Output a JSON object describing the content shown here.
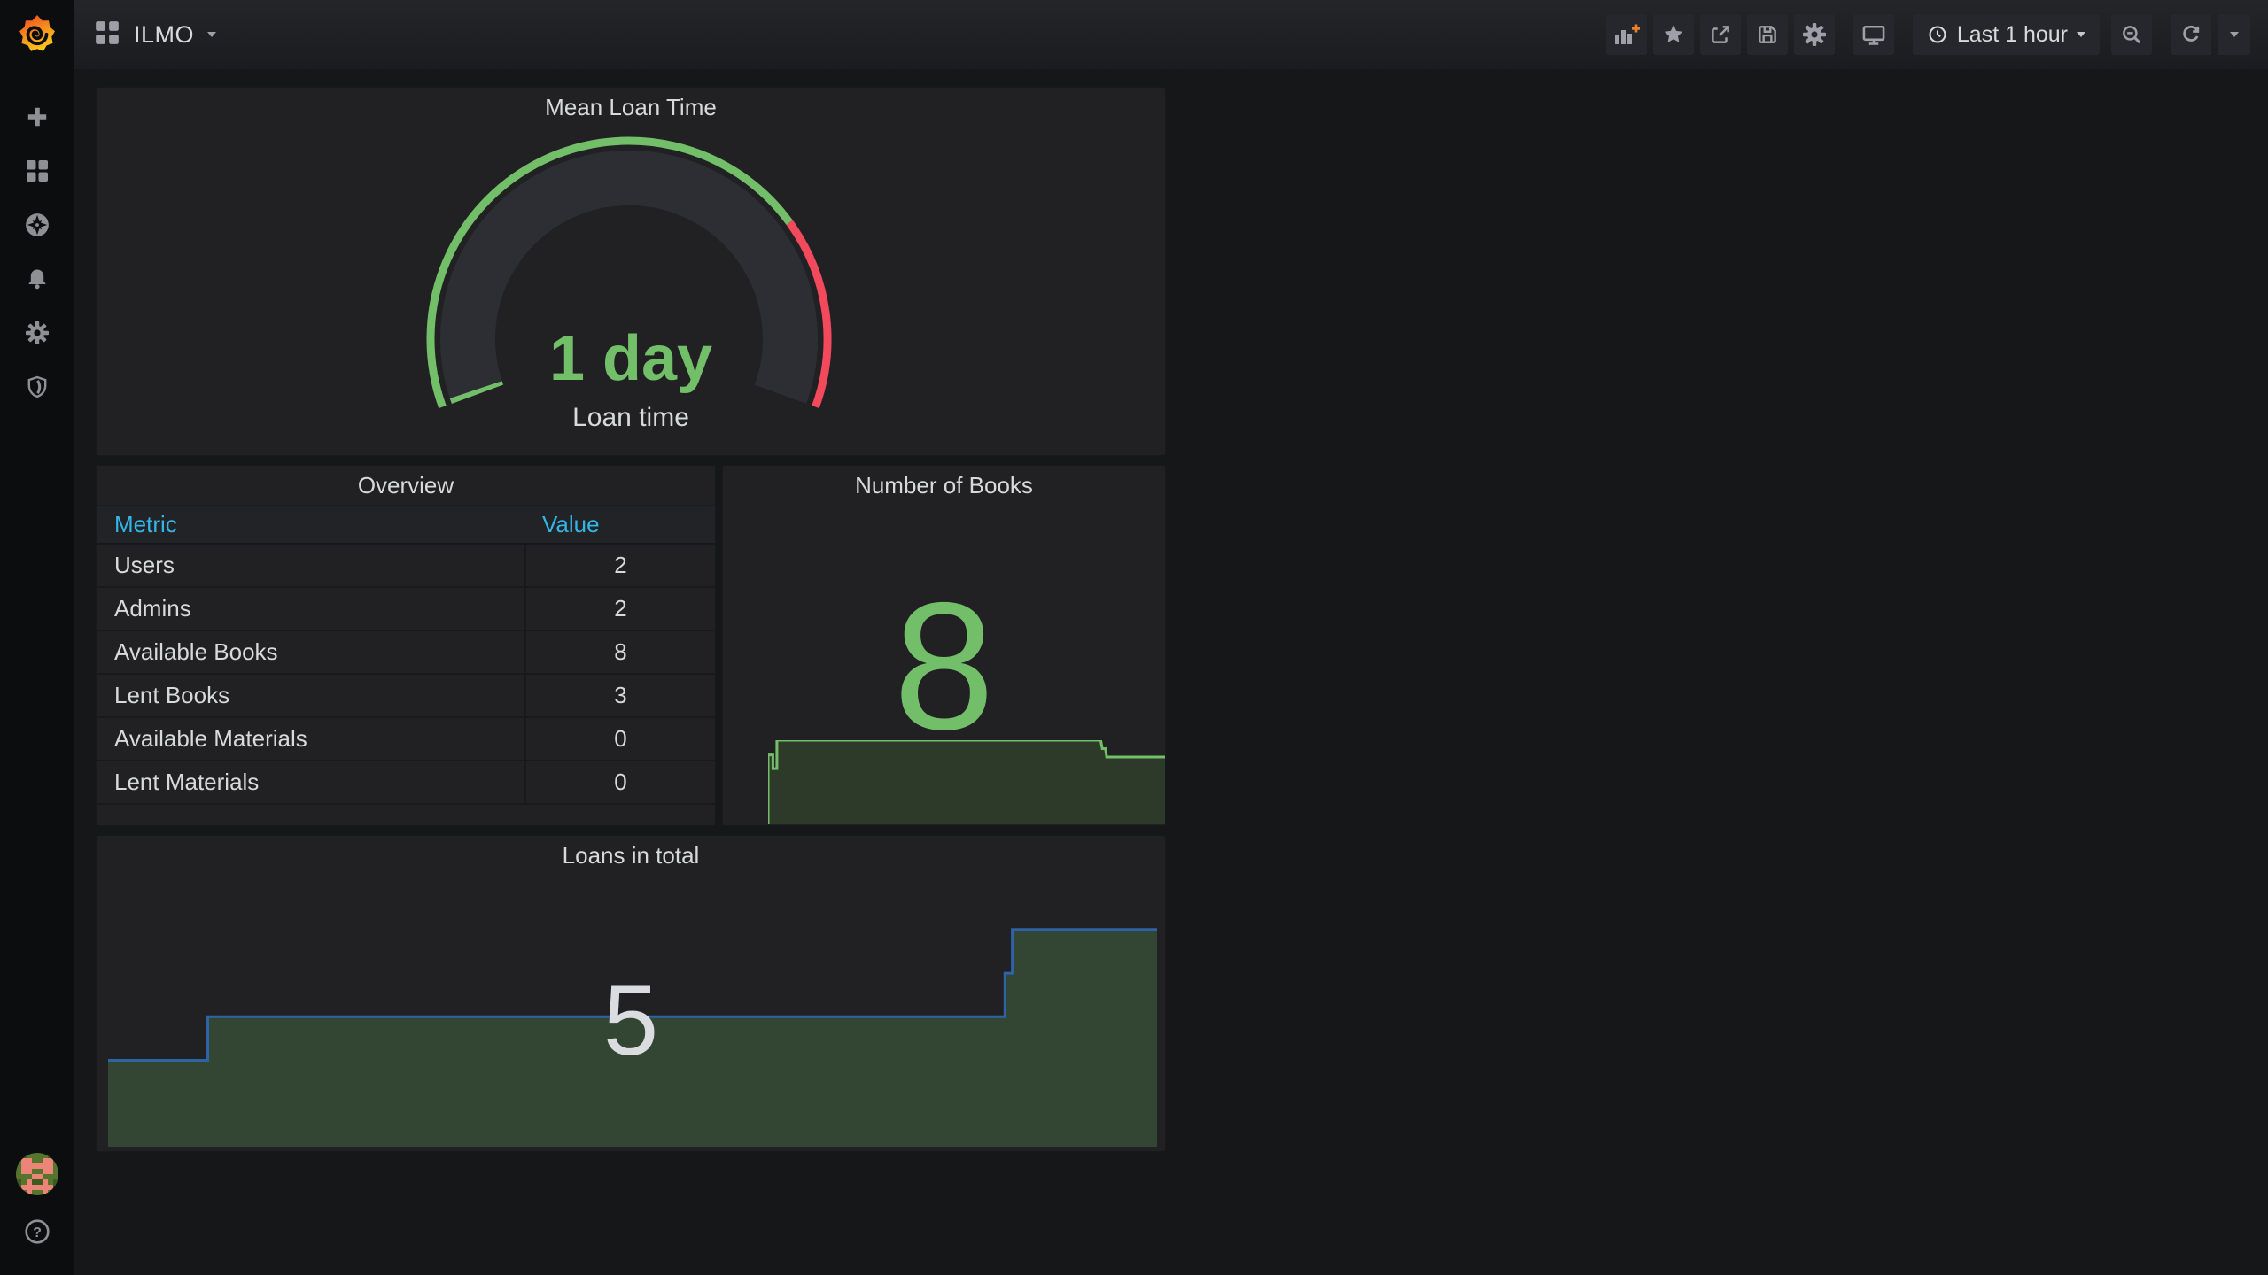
{
  "brand": {
    "name": "Grafana",
    "logo_icon": "grafana-flame-logo"
  },
  "topbar": {
    "dashboard_icon": "apps-grid-icon",
    "dashboard_title": "ILMO",
    "title_caret_icon": "caret-down-icon",
    "toolbar": {
      "add_panel_icon": "add-panel-icon",
      "star_icon": "star-icon",
      "share_icon": "share-icon",
      "save_icon": "save-icon",
      "settings_icon": "gear-icon",
      "cycle_view_icon": "monitor-icon",
      "time_picker": {
        "clock_icon": "clock-icon",
        "label": "Last 1 hour",
        "caret_icon": "caret-down-icon"
      },
      "zoom_out_icon": "magnifier-minus-icon",
      "refresh_icon": "refresh-icon",
      "refresh_caret_icon": "caret-down-icon"
    }
  },
  "sidebar": {
    "items": [
      {
        "name": "create",
        "icon": "plus-icon"
      },
      {
        "name": "dashboards",
        "icon": "apps-grid-icon"
      },
      {
        "name": "explore",
        "icon": "compass-icon"
      },
      {
        "name": "alerting",
        "icon": "bell-icon"
      },
      {
        "name": "configuration",
        "icon": "gear-icon"
      },
      {
        "name": "server-admin",
        "icon": "shield-icon"
      }
    ],
    "bottom": [
      {
        "name": "user-profile",
        "icon": "user-avatar"
      },
      {
        "name": "help",
        "icon": "question-mark-icon"
      }
    ]
  },
  "panels": {
    "overview": {
      "title": "Overview",
      "columns": [
        "Metric",
        "Value"
      ],
      "rows": [
        [
          "Users",
          "2"
        ],
        [
          "Admins",
          "2"
        ],
        [
          "Available Books",
          "8"
        ],
        [
          "Lent Books",
          "3"
        ],
        [
          "Available Materials",
          "0"
        ],
        [
          "Lent Materials",
          "0"
        ]
      ]
    }
  },
  "chart_data": [
    {
      "type": "gauge",
      "title": "Mean Loan Time",
      "value_text": "1 day",
      "value_label": "Loan time",
      "start_angle_deg": 200,
      "end_angle_deg": -20,
      "threshold_split_deg": 36,
      "value_sweep_deg": 1.7,
      "colors": {
        "ok": "#73BF69",
        "alert": "#F2495C",
        "track": "#2c2e33"
      }
    },
    {
      "type": "area",
      "title": "Number of Books",
      "current_value": 8,
      "ylim": [
        0,
        8
      ],
      "x_range_frac": [
        0.1,
        1.0
      ],
      "points": [
        [
          0,
          0
        ],
        [
          0,
          6.6
        ],
        [
          0.012,
          6.6
        ],
        [
          0.012,
          5.3
        ],
        [
          0.022,
          5.3
        ],
        [
          0.022,
          8
        ],
        [
          0.838,
          8
        ],
        [
          0.842,
          7.2
        ],
        [
          0.85,
          7.2
        ],
        [
          0.853,
          6.4
        ],
        [
          1,
          6.4
        ]
      ],
      "line_color": "#73BF69",
      "fill_color": "#2d3a2a"
    },
    {
      "type": "area",
      "title": "Loans in total",
      "current_value": 5,
      "ylim": [
        0,
        5.2
      ],
      "points": [
        [
          0,
          2
        ],
        [
          0.095,
          2
        ],
        [
          0.095,
          3
        ],
        [
          0.855,
          3
        ],
        [
          0.855,
          4
        ],
        [
          0.862,
          4
        ],
        [
          0.862,
          5
        ],
        [
          1,
          5
        ]
      ],
      "line_color": "#2e63a8",
      "fill_color": "#334533"
    }
  ]
}
